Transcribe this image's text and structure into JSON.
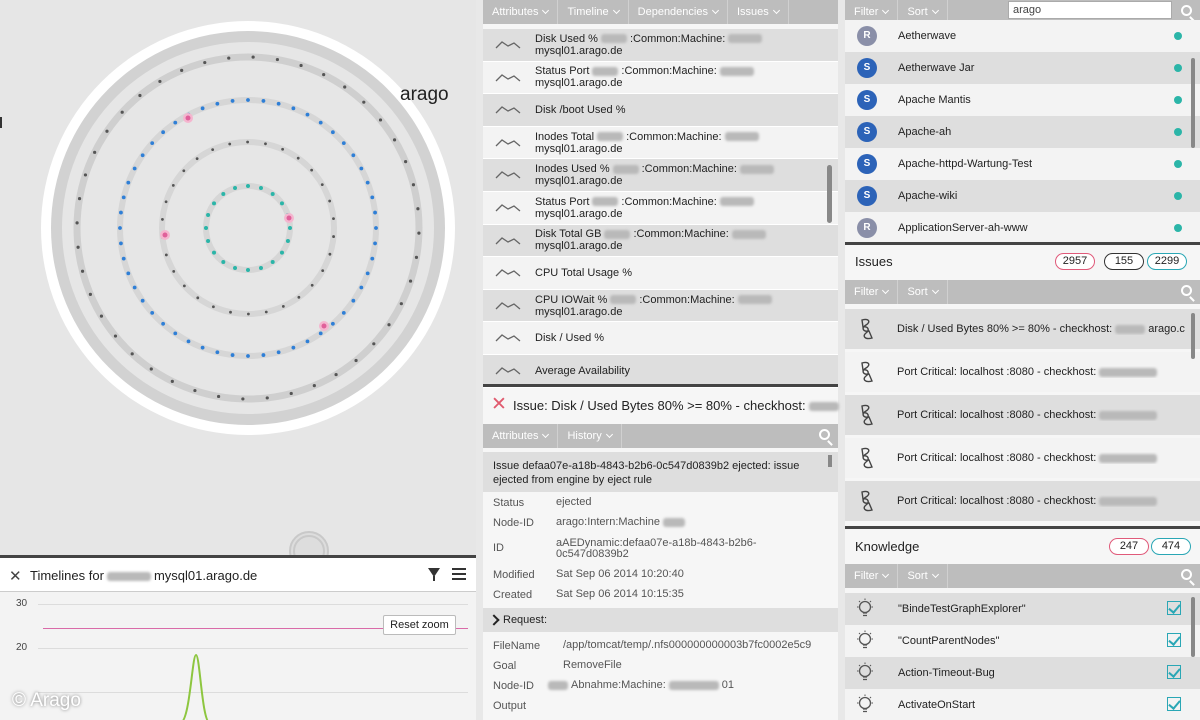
{
  "graph": {
    "brand_label": "arago",
    "colors": {
      "outer_ring": "#c9c9c9",
      "dot_dark": "#555555",
      "dot_blue": "#2f7fd6",
      "dot_teal": "#2bb5a8",
      "dot_pink": "#e0609a"
    }
  },
  "timeline": {
    "title_prefix": "Timelines for",
    "title_host": "mysql01.arago.de",
    "reset_zoom": "Reset zoom",
    "y_ticks": [
      "30",
      "20"
    ],
    "threshold_color": "#d96aa8",
    "series_color": "#8dc63f"
  },
  "copyright": "© Arago",
  "attributes_panel": {
    "tabs": [
      "Attributes",
      "Timeline",
      "Dependencies",
      "Issues"
    ],
    "metrics": [
      {
        "label_a": "Disk Used %",
        "label_b": ":Common:Machine:",
        "label_c": "mysql01.arago.de"
      },
      {
        "label_a": "Status Port",
        "label_b": ":Common:Machine:",
        "label_c": "mysql01.arago.de"
      },
      {
        "label_a": "Disk /boot Used %",
        "label_b": "",
        "label_c": ""
      },
      {
        "label_a": "Inodes Total",
        "label_b": ":Common:Machine:",
        "label_c": "mysql01.arago.de"
      },
      {
        "label_a": "Inodes Used %",
        "label_b": ":Common:Machine:",
        "label_c": "mysql01.arago.de"
      },
      {
        "label_a": "Status Port",
        "label_b": ":Common:Machine:",
        "label_c": "mysql01.arago.de"
      },
      {
        "label_a": "Disk Total GB",
        "label_b": ":Common:Machine:",
        "label_c": "mysql01.arago.de"
      },
      {
        "label_a": "CPU Total Usage %",
        "label_b": "",
        "label_c": ""
      },
      {
        "label_a": "CPU IOWait %",
        "label_b": ":Common:Machine:",
        "label_c": "mysql01.arago.de"
      },
      {
        "label_a": "Disk / Used %",
        "label_b": "",
        "label_c": ""
      },
      {
        "label_a": "Average Availability",
        "label_b": "",
        "label_c": ""
      }
    ]
  },
  "issue_detail": {
    "title": "Issue: Disk / Used Bytes 80% >= 80% - checkhost:",
    "tabs": [
      "Attributes",
      "History"
    ],
    "summary": "Issue defaa07e-a18b-4843-b2b6-0c547d0839b2 ejected: issue ejected from engine by eject rule",
    "attributes": [
      {
        "key": "Status",
        "value": "ejected"
      },
      {
        "key": "Node-ID",
        "value": "arago:Intern:Machine"
      },
      {
        "key": "ID",
        "value": "aAEDynamic:defaa07e-a18b-4843-b2b6-0c547d0839b2"
      },
      {
        "key": "Modified",
        "value": "Sat Sep 06 2014 10:20:40"
      },
      {
        "key": "Created",
        "value": "Sat Sep 06 2014 10:15:35"
      }
    ],
    "request_label": "Request:",
    "request_fields": [
      {
        "key": "FileName",
        "value": "/app/tomcat/temp/.nfs000000000003b7fc0002e5c9"
      },
      {
        "key": "Goal",
        "value": "RemoveFile"
      },
      {
        "key": "Node-ID",
        "value": "Abnahme:Machine:"
      },
      {
        "key": "Output",
        "value": ""
      }
    ],
    "request_node_suffix": "01",
    "close_color": "#e05a6e"
  },
  "applications_panel": {
    "filter_label": "Filter",
    "sort_label": "Sort",
    "search_value": "arago",
    "items": [
      {
        "badge": "R",
        "name": "Aetherwave",
        "badge_color": "#8a8fa8"
      },
      {
        "badge": "S",
        "name": "Aetherwave Jar",
        "badge_color": "#2c63b8"
      },
      {
        "badge": "S",
        "name": "Apache Mantis",
        "badge_color": "#2c63b8"
      },
      {
        "badge": "S",
        "name": "Apache-ah",
        "badge_color": "#2c63b8"
      },
      {
        "badge": "S",
        "name": "Apache-httpd-Wartung-Test",
        "badge_color": "#2c63b8"
      },
      {
        "badge": "S",
        "name": "Apache-wiki",
        "badge_color": "#2c63b8"
      },
      {
        "badge": "R",
        "name": "ApplicationServer-ah-www",
        "badge_color": "#8a8fa8"
      }
    ],
    "status_color": "#2bb5a8"
  },
  "issues_section": {
    "title": "Issues",
    "counts": [
      {
        "value": "2957",
        "color": "#e05a7a"
      },
      {
        "value": "155",
        "color": "#333333"
      },
      {
        "value": "2299",
        "color": "#2aa7b5"
      }
    ],
    "filter_label": "Filter",
    "sort_label": "Sort",
    "items": [
      {
        "text": "Disk / Used Bytes 80% >= 80% - checkhost:",
        "suffix": "arago.c"
      },
      {
        "text": "Port Critical: localhost :8080 - checkhost:",
        "suffix": ""
      },
      {
        "text": "Port Critical: localhost :8080 - checkhost:",
        "suffix": ""
      },
      {
        "text": "Port Critical: localhost :8080 - checkhost:",
        "suffix": ""
      },
      {
        "text": "Port Critical: localhost :8080 - checkhost:",
        "suffix": ""
      }
    ]
  },
  "knowledge_section": {
    "title": "Knowledge",
    "counts": [
      {
        "value": "247",
        "color": "#e05a7a"
      },
      {
        "value": "474",
        "color": "#2aa7b5"
      }
    ],
    "filter_label": "Filter",
    "sort_label": "Sort",
    "items": [
      {
        "name": "\"BindeTestGraphExplorer\""
      },
      {
        "name": "\"CountParentNodes\""
      },
      {
        "name": "Action-Timeout-Bug"
      },
      {
        "name": "ActivateOnStart"
      }
    ]
  }
}
